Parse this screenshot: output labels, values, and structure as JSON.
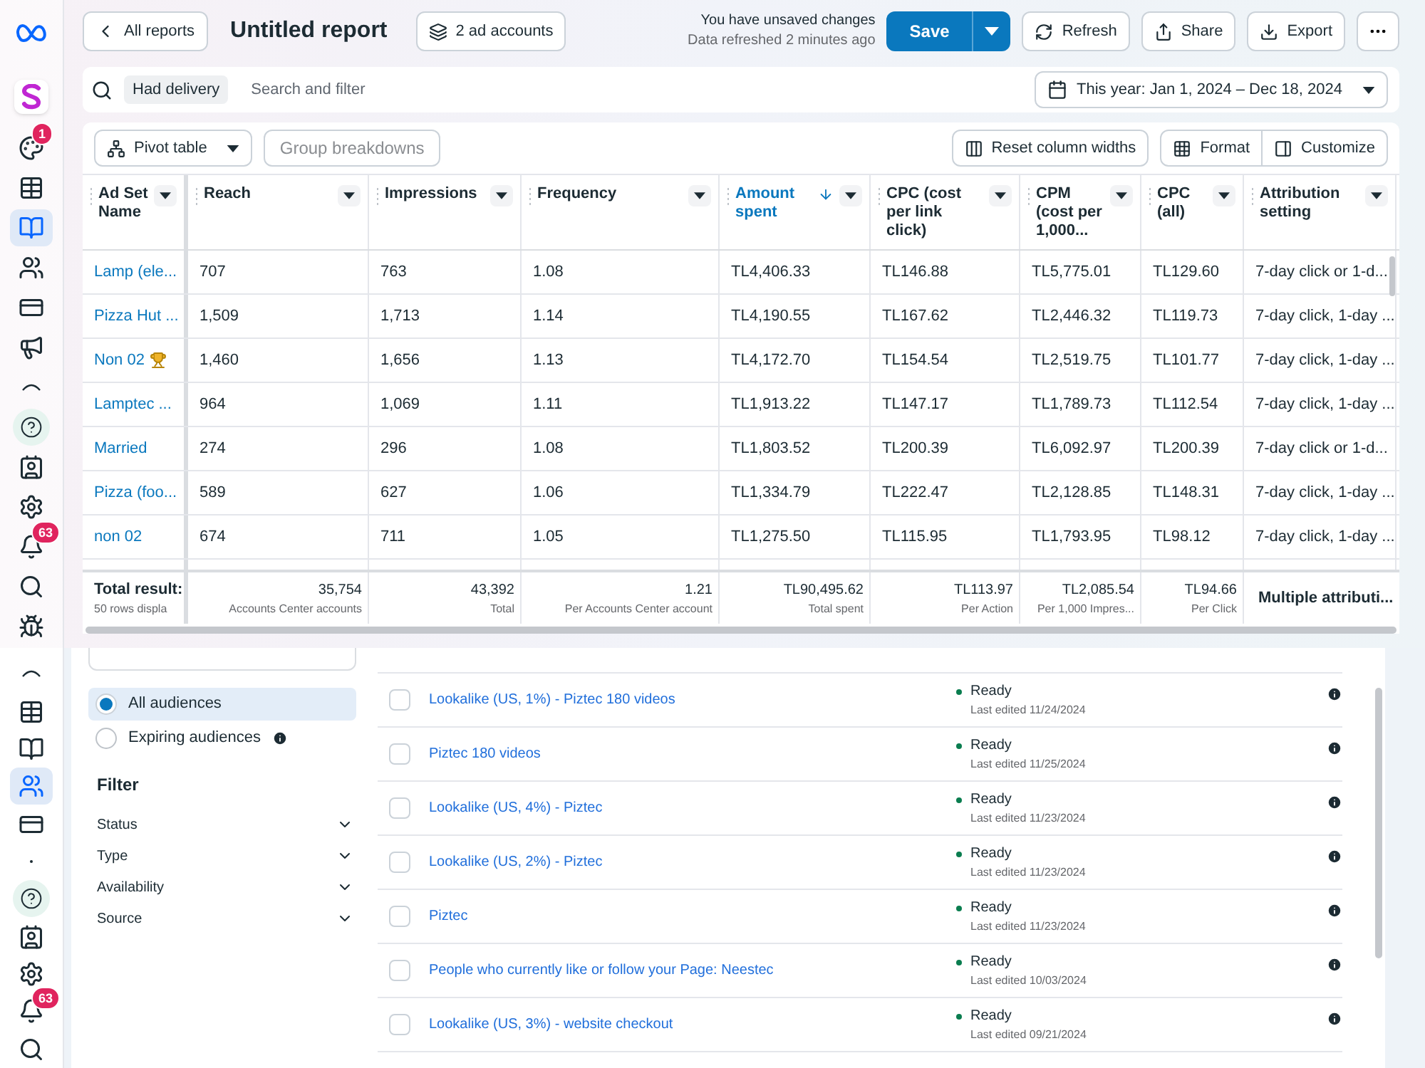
{
  "report": {
    "sidebar": {
      "items": [
        {
          "kind": "meta",
          "selected": false
        },
        {
          "kind": "brand",
          "selected": false
        },
        {
          "kind": "palette",
          "selected": false,
          "badge": "1"
        },
        {
          "kind": "table",
          "selected": false
        },
        {
          "kind": "reports",
          "selected": true
        },
        {
          "kind": "audiences",
          "selected": false
        },
        {
          "kind": "billing",
          "selected": false
        },
        {
          "kind": "megaphone",
          "selected": false
        },
        {
          "kind": "arc",
          "selected": false
        },
        {
          "kind": "help",
          "selected": false
        },
        {
          "kind": "contact",
          "selected": false
        },
        {
          "kind": "settings",
          "selected": false
        },
        {
          "kind": "bell",
          "selected": false,
          "badge": "63"
        },
        {
          "kind": "search",
          "selected": false
        },
        {
          "kind": "bug",
          "selected": false
        }
      ]
    },
    "header": {
      "back": "All reports",
      "title": "Untitled report",
      "accounts": "2 ad accounts",
      "unsaved": "You have unsaved changes",
      "refreshed": "Data refreshed 2 minutes ago",
      "save": "Save",
      "refresh": "Refresh",
      "share": "Share",
      "export": "Export"
    },
    "filter": {
      "chip": "Had delivery",
      "placeholder": "Search and filter",
      "date": "This year: Jan 1, 2024 – Dec 18, 2024"
    },
    "toolbar": {
      "pivot": "Pivot table",
      "group": {
        "label": "Group breakdowns",
        "disabled": true
      },
      "reset": "Reset column widths",
      "format": "Format",
      "customize": "Customize"
    },
    "table": {
      "columns": [
        {
          "label": "Ad Set Name",
          "sorted": false
        },
        {
          "label": "Reach",
          "sorted": false
        },
        {
          "label": "Impressions",
          "sorted": false
        },
        {
          "label": "Frequency",
          "sorted": false
        },
        {
          "label": "Amount spent",
          "sorted": true
        },
        {
          "label": "CPC (cost per link click)",
          "sorted": false
        },
        {
          "label": "CPM (cost per 1,000...",
          "sorted": false
        },
        {
          "label": "CPC (all)",
          "sorted": false
        },
        {
          "label": "Attribution setting",
          "sorted": false
        }
      ],
      "rows": [
        {
          "trophy": false,
          "cells": [
            "Lamp (ele...",
            "707",
            "763",
            "1.08",
            "TL4,406.33",
            "TL146.88",
            "TL5,775.01",
            "TL129.60",
            "7-day click or 1-d..."
          ]
        },
        {
          "trophy": false,
          "cells": [
            "Pizza Hut ...",
            "1,509",
            "1,713",
            "1.14",
            "TL4,190.55",
            "TL167.62",
            "TL2,446.32",
            "TL119.73",
            "7-day click, 1-day ..."
          ]
        },
        {
          "trophy": true,
          "cells": [
            "Non 02",
            "1,460",
            "1,656",
            "1.13",
            "TL4,172.70",
            "TL154.54",
            "TL2,519.75",
            "TL101.77",
            "7-day click, 1-day ..."
          ]
        },
        {
          "trophy": false,
          "cells": [
            "Lamptec ...",
            "964",
            "1,069",
            "1.11",
            "TL1,913.22",
            "TL147.17",
            "TL1,789.73",
            "TL112.54",
            "7-day click, 1-day ..."
          ]
        },
        {
          "trophy": false,
          "cells": [
            "Married",
            "274",
            "296",
            "1.08",
            "TL1,803.52",
            "TL200.39",
            "TL6,092.97",
            "TL200.39",
            "7-day click or 1-d..."
          ]
        },
        {
          "trophy": false,
          "cells": [
            "Pizza (foo...",
            "589",
            "627",
            "1.06",
            "TL1,334.79",
            "TL222.47",
            "TL2,128.85",
            "TL148.31",
            "7-day click, 1-day ..."
          ]
        },
        {
          "trophy": false,
          "cells": [
            "non 02",
            "674",
            "711",
            "1.05",
            "TL1,275.50",
            "TL115.95",
            "TL1,793.95",
            "TL98.12",
            "7-day click, 1-day ..."
          ]
        }
      ],
      "totals": [
        {
          "value": "Total result:",
          "note": "50 rows displa"
        },
        {
          "value": "35,754",
          "note": "Accounts Center accounts"
        },
        {
          "value": "43,392",
          "note": "Total"
        },
        {
          "value": "1.21",
          "note": "Per Accounts Center account"
        },
        {
          "value": "TL90,495.62",
          "note": "Total spent"
        },
        {
          "value": "TL113.97",
          "note": "Per Action"
        },
        {
          "value": "TL2,085.54",
          "note": "Per 1,000 Impres..."
        },
        {
          "value": "TL94.66",
          "note": "Per Click"
        },
        {
          "value": "Multiple attributi..."
        }
      ]
    }
  },
  "audiences": {
    "sidebar": {
      "items": [
        {
          "kind": "arc",
          "selected": false
        },
        {
          "kind": "table",
          "selected": false
        },
        {
          "kind": "reports",
          "selected": false
        },
        {
          "kind": "audiences",
          "selected": true
        },
        {
          "kind": "billing",
          "selected": false
        },
        {
          "kind": "dot",
          "selected": false
        },
        {
          "kind": "help",
          "selected": false
        },
        {
          "kind": "contact",
          "selected": false
        },
        {
          "kind": "settings",
          "selected": false
        },
        {
          "kind": "bell",
          "selected": false,
          "badge": "63"
        },
        {
          "kind": "search",
          "selected": false
        }
      ]
    },
    "views": [
      {
        "label": "All audiences",
        "selected": true,
        "info": false
      },
      {
        "label": "Expiring audiences",
        "selected": false,
        "info": true
      }
    ],
    "filter_title": "Filter",
    "filters": [
      {
        "label": "Status",
        "expanded": false
      },
      {
        "label": "Type",
        "expanded": false
      },
      {
        "label": "Availability",
        "expanded": false
      },
      {
        "label": "Source",
        "expanded": false
      }
    ],
    "rows": [
      {
        "checked": false,
        "name": "Lookalike (US, 1%) - Piztec 180 videos",
        "status": "Ready",
        "edited": "Last edited 11/24/2024"
      },
      {
        "checked": false,
        "name": "Piztec 180 videos",
        "status": "Ready",
        "edited": "Last edited 11/25/2024"
      },
      {
        "checked": false,
        "name": "Lookalike (US, 4%) - Piztec",
        "status": "Ready",
        "edited": "Last edited 11/23/2024"
      },
      {
        "checked": false,
        "name": "Lookalike (US, 2%) - Piztec",
        "status": "Ready",
        "edited": "Last edited 11/23/2024"
      },
      {
        "checked": false,
        "name": "Piztec",
        "status": "Ready",
        "edited": "Last edited 11/23/2024"
      },
      {
        "checked": false,
        "name": "People who currently like or follow your Page: Neestec",
        "status": "Ready",
        "edited": "Last edited 10/03/2024"
      },
      {
        "checked": false,
        "name": "Lookalike (US, 3%) - website checkout",
        "status": "Ready",
        "edited": "Last edited 09/21/2024"
      }
    ]
  }
}
